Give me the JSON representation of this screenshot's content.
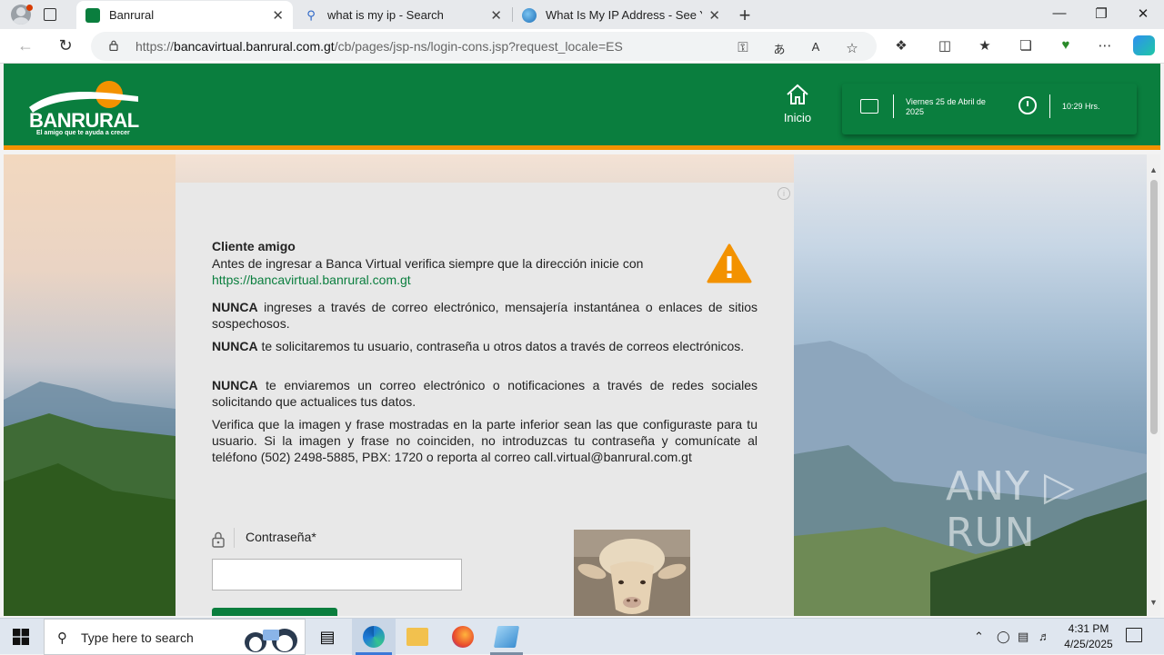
{
  "browser": {
    "tabs": [
      {
        "title": "Banrural",
        "active": true
      },
      {
        "title": "what is my ip - Search",
        "active": false
      },
      {
        "title": "What Is My IP Address - See Your",
        "active": false
      }
    ],
    "url": {
      "prefix": "https://",
      "host": "bancavirtual.banrural.com.gt",
      "path": "/cb/pages/jsp-ns/login-cons.jsp?request_locale=ES"
    },
    "close_glyph": "✕",
    "new_tab_glyph": "+",
    "window_controls": {
      "minimize": "—",
      "maximize": "❐",
      "close": "✕"
    }
  },
  "header": {
    "logo_text": "BANRURAL",
    "logo_tagline": "El amigo que te ayuda a crecer",
    "home_label": "Inicio",
    "date_text": "Viernes 25 de Abril de 2025",
    "time_text": "10:29 Hrs."
  },
  "notice": {
    "title": "Cliente amigo",
    "intro": "Antes de ingresar a Banca Virtual verifica siempre que la dirección inicie con",
    "link": "https://bancavirtual.banrural.com.gt",
    "items": [
      {
        "strong": "NUNCA",
        "text": " ingreses a través de correo electrónico, mensajería instantánea o enlaces de sitios sospechosos."
      },
      {
        "strong": "NUNCA",
        "text": " te solicitaremos tu usuario, contraseña u otros datos a través de correos electrónicos."
      },
      {
        "strong": "NUNCA",
        "text": " te enviaremos un correo electrónico o notificaciones a través de redes sociales solicitando que actualices tus datos."
      }
    ],
    "verify_text": "Verifica que la imagen y frase mostradas en la parte inferior sean las que configuraste para tu usuario. Si la imagen y frase no coinciden, no introduzcas tu contraseña y comunícate al teléfono (502) 2498-5885, PBX: 1720 o reporta al correo call.virtual@banrural.com.gt"
  },
  "login": {
    "password_label": "Contraseña*",
    "password_value": ""
  },
  "watermark": "ANY ▷ RUN",
  "taskbar": {
    "search_placeholder": "Type here to search",
    "time": "4:31 PM",
    "date": "4/25/2025"
  },
  "colors": {
    "brand_green": "#0a7e3e",
    "brand_orange": "#f39200",
    "card_bg": "#e8e8e8"
  },
  "icons": [
    "profile-icon",
    "tab-actions-icon",
    "search-icon",
    "globe-icon",
    "back-icon",
    "refresh-icon",
    "lock-icon",
    "key-icon",
    "translate-icon",
    "read-aloud-icon",
    "star-icon",
    "extensions-icon",
    "split-screen-icon",
    "favorites-icon",
    "collections-icon",
    "performance-icon",
    "more-icon",
    "copilot-icon",
    "home-icon",
    "calendar-icon",
    "clock-icon",
    "warning-icon",
    "padlock-icon",
    "windows-icon",
    "task-view-icon",
    "edge-icon",
    "file-explorer-icon",
    "firefox-icon",
    "notepad-icon",
    "notification-icon"
  ]
}
